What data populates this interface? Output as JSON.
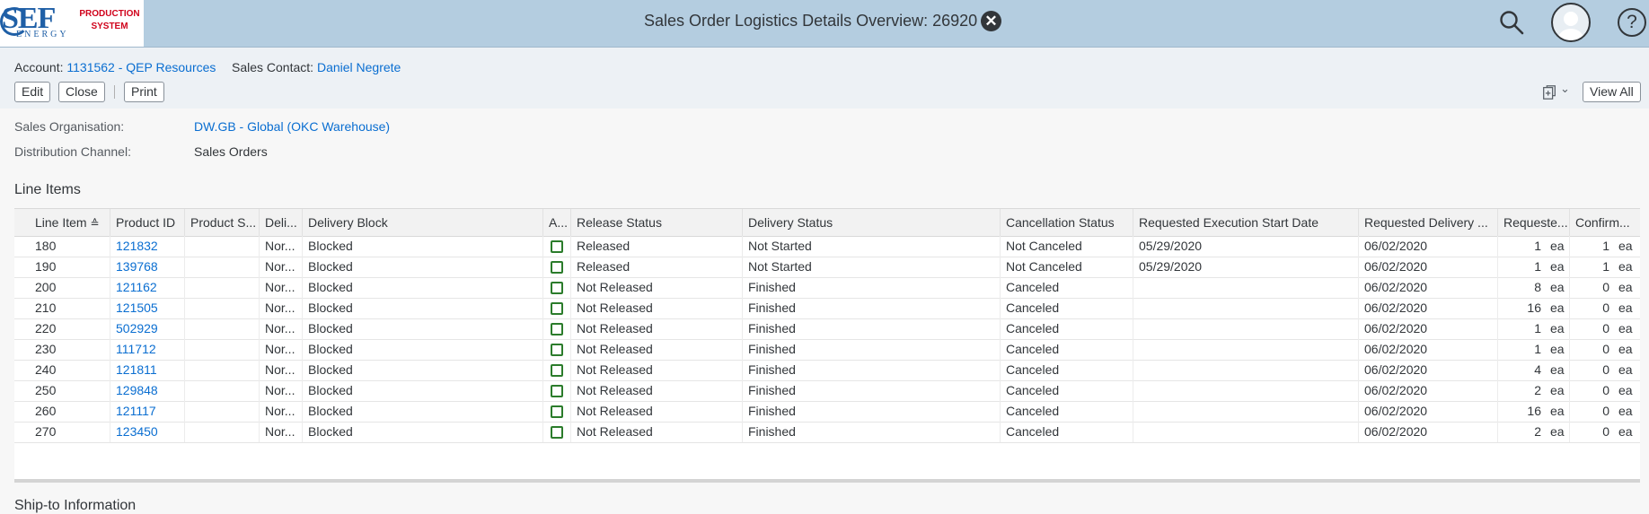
{
  "logo": {
    "brand": "SEF",
    "sub": "ENERGY",
    "tag_line1": "PRODUCTION",
    "tag_line2": "SYSTEM"
  },
  "shell": {
    "title": "Sales Order Logistics Details Overview: 26920",
    "close_glyph": "✕",
    "help_glyph": "?"
  },
  "header": {
    "account_label": "Account:",
    "account_value": "1131562 - QEP Resources",
    "contact_label": "Sales Contact:",
    "contact_value": "Daniel Negrete",
    "edit": "Edit",
    "close": "Close",
    "print": "Print",
    "share_chevron": "⌄",
    "view_all": "View All"
  },
  "fields": {
    "sales_org_label": "Sales Organisation:",
    "sales_org_value": "DW.GB - Global (OKC Warehouse)",
    "dist_channel_label": "Distribution Channel:",
    "dist_channel_value": "Sales Orders"
  },
  "line_items": {
    "title": "Line Items",
    "columns": [
      "Line Item",
      "Product ID",
      "Product S...",
      "Deli...",
      "Delivery Block",
      "A...",
      "Release Status",
      "Delivery Status",
      "Cancellation Status",
      "Requested Execution Start Date",
      "Requested Delivery ...",
      "Requeste...",
      "Confirm..."
    ],
    "sort_glyph": "≙",
    "rows": [
      {
        "line": "180",
        "product": "121832",
        "prod_s": "",
        "deli": "Nor...",
        "block": "Blocked",
        "release": "Released",
        "delivery": "Not Started",
        "cancel": "Not Canceled",
        "exec_date": "05/29/2020",
        "deliv_date": "06/02/2020",
        "req_qty": "1",
        "req_unit": "ea",
        "conf_qty": "1",
        "conf_unit": "ea"
      },
      {
        "line": "190",
        "product": "139768",
        "prod_s": "",
        "deli": "Nor...",
        "block": "Blocked",
        "release": "Released",
        "delivery": "Not Started",
        "cancel": "Not Canceled",
        "exec_date": "05/29/2020",
        "deliv_date": "06/02/2020",
        "req_qty": "1",
        "req_unit": "ea",
        "conf_qty": "1",
        "conf_unit": "ea"
      },
      {
        "line": "200",
        "product": "121162",
        "prod_s": "",
        "deli": "Nor...",
        "block": "Blocked",
        "release": "Not Released",
        "delivery": "Finished",
        "cancel": "Canceled",
        "exec_date": "",
        "deliv_date": "06/02/2020",
        "req_qty": "8",
        "req_unit": "ea",
        "conf_qty": "0",
        "conf_unit": "ea"
      },
      {
        "line": "210",
        "product": "121505",
        "prod_s": "",
        "deli": "Nor...",
        "block": "Blocked",
        "release": "Not Released",
        "delivery": "Finished",
        "cancel": "Canceled",
        "exec_date": "",
        "deliv_date": "06/02/2020",
        "req_qty": "16",
        "req_unit": "ea",
        "conf_qty": "0",
        "conf_unit": "ea"
      },
      {
        "line": "220",
        "product": "502929",
        "prod_s": "",
        "deli": "Nor...",
        "block": "Blocked",
        "release": "Not Released",
        "delivery": "Finished",
        "cancel": "Canceled",
        "exec_date": "",
        "deliv_date": "06/02/2020",
        "req_qty": "1",
        "req_unit": "ea",
        "conf_qty": "0",
        "conf_unit": "ea"
      },
      {
        "line": "230",
        "product": "111712",
        "prod_s": "",
        "deli": "Nor...",
        "block": "Blocked",
        "release": "Not Released",
        "delivery": "Finished",
        "cancel": "Canceled",
        "exec_date": "",
        "deliv_date": "06/02/2020",
        "req_qty": "1",
        "req_unit": "ea",
        "conf_qty": "0",
        "conf_unit": "ea"
      },
      {
        "line": "240",
        "product": "121811",
        "prod_s": "",
        "deli": "Nor...",
        "block": "Blocked",
        "release": "Not Released",
        "delivery": "Finished",
        "cancel": "Canceled",
        "exec_date": "",
        "deliv_date": "06/02/2020",
        "req_qty": "4",
        "req_unit": "ea",
        "conf_qty": "0",
        "conf_unit": "ea"
      },
      {
        "line": "250",
        "product": "129848",
        "prod_s": "",
        "deli": "Nor...",
        "block": "Blocked",
        "release": "Not Released",
        "delivery": "Finished",
        "cancel": "Canceled",
        "exec_date": "",
        "deliv_date": "06/02/2020",
        "req_qty": "2",
        "req_unit": "ea",
        "conf_qty": "0",
        "conf_unit": "ea"
      },
      {
        "line": "260",
        "product": "121117",
        "prod_s": "",
        "deli": "Nor...",
        "block": "Blocked",
        "release": "Not Released",
        "delivery": "Finished",
        "cancel": "Canceled",
        "exec_date": "",
        "deliv_date": "06/02/2020",
        "req_qty": "16",
        "req_unit": "ea",
        "conf_qty": "0",
        "conf_unit": "ea"
      },
      {
        "line": "270",
        "product": "123450",
        "prod_s": "",
        "deli": "Nor...",
        "block": "Blocked",
        "release": "Not Released",
        "delivery": "Finished",
        "cancel": "Canceled",
        "exec_date": "",
        "deliv_date": "06/02/2020",
        "req_qty": "2",
        "req_unit": "ea",
        "conf_qty": "0",
        "conf_unit": "ea"
      }
    ]
  },
  "ship_to": {
    "title": "Ship-to Information"
  },
  "icons": {
    "search": "search-icon",
    "avatar": "user-avatar-icon",
    "help": "help-icon",
    "close": "close-circle-icon",
    "share": "share-icon",
    "checkbox": "checkbox-icon"
  },
  "colors": {
    "shell_bar": "#b4cde0",
    "link": "#0a6ed1",
    "checkbox_border": "#2b7c2b",
    "logo_red": "#d0021b",
    "logo_blue": "#1f5fa6"
  }
}
